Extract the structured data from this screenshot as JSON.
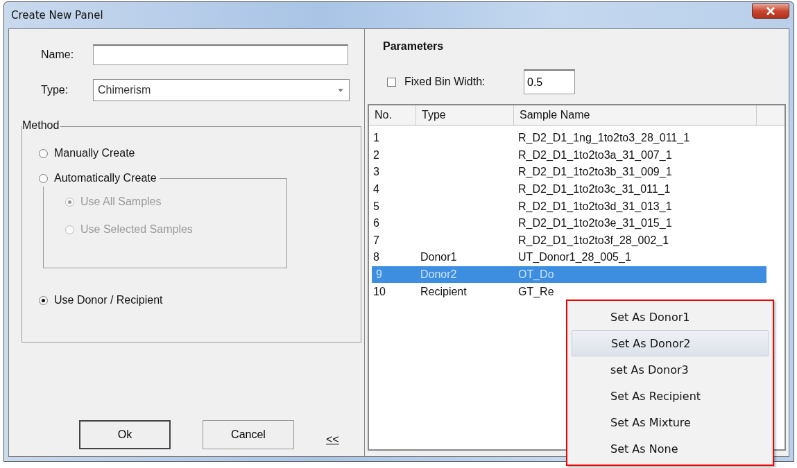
{
  "window": {
    "title": "Create New Panel"
  },
  "name_field": {
    "label": "Name:"
  },
  "type_field": {
    "label": "Type:",
    "value": "Chimerism"
  },
  "method": {
    "legend": "Method",
    "options": [
      {
        "label": "Manually Create",
        "selected": false,
        "disabled": false
      },
      {
        "label": "Automatically Create",
        "selected": false,
        "disabled": false,
        "children": [
          {
            "label": "Use All Samples",
            "selected": true,
            "disabled": true
          },
          {
            "label": "Use Selected Samples",
            "selected": false,
            "disabled": true
          }
        ]
      },
      {
        "label": "Use Donor / Recipient",
        "selected": true,
        "disabled": false
      }
    ]
  },
  "buttons": [
    {
      "label": "Ok",
      "kind": "default"
    },
    {
      "label": "Cancel",
      "kind": "normal"
    },
    {
      "label": "<<",
      "kind": "link"
    }
  ],
  "parameters": {
    "heading": "Parameters",
    "fixed_bin": {
      "label": "Fixed Bin Width:",
      "checked": false,
      "value": "0.5"
    }
  },
  "table": {
    "columns": [
      "No.",
      "Type",
      "Sample Name"
    ],
    "rows": [
      {
        "cells": [
          "1",
          "",
          "R_D2_D1_1ng_1to2to3_28_011_1"
        ],
        "selected": false
      },
      {
        "cells": [
          "2",
          "",
          "R_D2_D1_1to2to3a_31_007_1"
        ],
        "selected": false
      },
      {
        "cells": [
          "3",
          "",
          "R_D2_D1_1to2to3b_31_009_1"
        ],
        "selected": false
      },
      {
        "cells": [
          "4",
          "",
          "R_D2_D1_1to2to3c_31_011_1"
        ],
        "selected": false
      },
      {
        "cells": [
          "5",
          "",
          "R_D2_D1_1to2to3d_31_013_1"
        ],
        "selected": false
      },
      {
        "cells": [
          "6",
          "",
          "R_D2_D1_1to2to3e_31_015_1"
        ],
        "selected": false
      },
      {
        "cells": [
          "7",
          "",
          "R_D2_D1_1to2to3f_28_002_1"
        ],
        "selected": false
      },
      {
        "cells": [
          "8",
          "Donor1",
          "UT_Donor1_28_005_1"
        ],
        "selected": false
      },
      {
        "cells": [
          "9",
          "Donor2",
          "OT_Do"
        ],
        "selected": true
      },
      {
        "cells": [
          "10",
          "Recipient",
          "GT_Re"
        ],
        "selected": false
      }
    ]
  },
  "context_menu": {
    "items": [
      {
        "label": "Set As Donor1",
        "selected": false
      },
      {
        "label": "Set As Donor2",
        "selected": true
      },
      {
        "label": "set As Donor3",
        "selected": false
      },
      {
        "label": "Set As Recipient",
        "selected": false
      },
      {
        "label": "Set As Mixture",
        "selected": false
      },
      {
        "label": "Set As None",
        "selected": false
      }
    ]
  }
}
